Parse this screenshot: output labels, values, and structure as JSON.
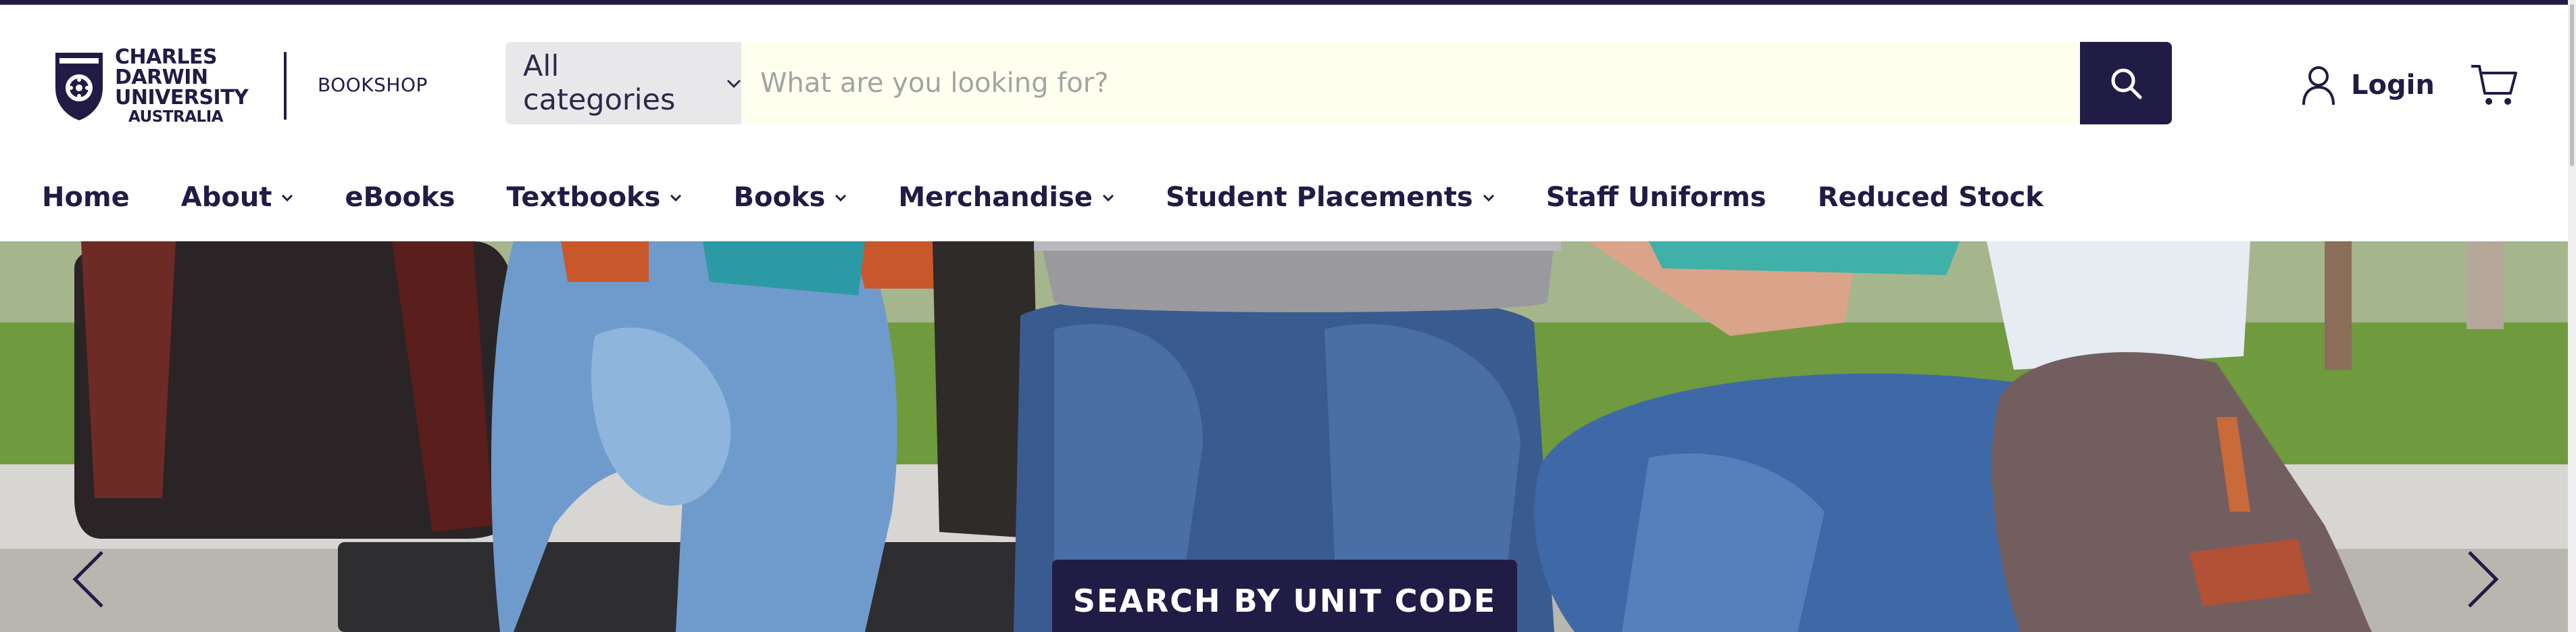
{
  "logo": {
    "lines": [
      "CHARLES",
      "DARWIN",
      "UNIVERSITY",
      "AUSTRALIA"
    ],
    "shop_label": "BOOKSHOP"
  },
  "search": {
    "category_label": "All categories",
    "placeholder": "What are you looking for?",
    "value": ""
  },
  "icons": {
    "search": "search-icon",
    "user": "user-icon",
    "cart": "cart-icon",
    "left": "chevron-left-icon",
    "right": "chevron-right-icon"
  },
  "account": {
    "login_label": "Login"
  },
  "nav": {
    "items": [
      {
        "label": "Home",
        "has_dropdown": false
      },
      {
        "label": "About",
        "has_dropdown": true
      },
      {
        "label": "eBooks",
        "has_dropdown": false
      },
      {
        "label": "Textbooks",
        "has_dropdown": true
      },
      {
        "label": "Books",
        "has_dropdown": true
      },
      {
        "label": "Merchandise",
        "has_dropdown": true
      },
      {
        "label": "Student Placements",
        "has_dropdown": true
      },
      {
        "label": "Staff Uniforms",
        "has_dropdown": false
      },
      {
        "label": "Reduced Stock",
        "has_dropdown": false
      }
    ]
  },
  "hero": {
    "cta_label": "SEARCH BY UNIT CODE"
  },
  "colors": {
    "brand_navy": "#201c45",
    "search_bg": "#fffff0",
    "category_bg": "#e8e8ea"
  }
}
